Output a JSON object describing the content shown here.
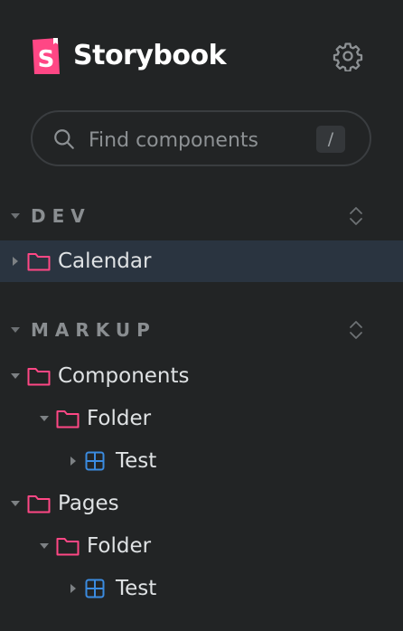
{
  "app": {
    "name": "Storybook",
    "accent": "#ff4785",
    "component_color": "#3b8be0"
  },
  "header": {
    "settings_icon": "gear-icon"
  },
  "search": {
    "placeholder": "Find components",
    "shortcut": "/"
  },
  "sections": [
    {
      "title": "DEV",
      "items": [
        {
          "label": "Calendar",
          "type": "folder",
          "expanded": false,
          "selected": true
        }
      ]
    },
    {
      "title": "MARKUP",
      "items": [
        {
          "label": "Components",
          "type": "folder",
          "expanded": true,
          "level": 0
        },
        {
          "label": "Folder",
          "type": "folder",
          "expanded": true,
          "level": 1
        },
        {
          "label": "Test",
          "type": "component",
          "expanded": false,
          "level": 2
        },
        {
          "label": "Pages",
          "type": "folder",
          "expanded": true,
          "level": 0
        },
        {
          "label": "Folder",
          "type": "folder",
          "expanded": true,
          "level": 1
        },
        {
          "label": "Test",
          "type": "component",
          "expanded": false,
          "level": 2
        }
      ]
    }
  ]
}
